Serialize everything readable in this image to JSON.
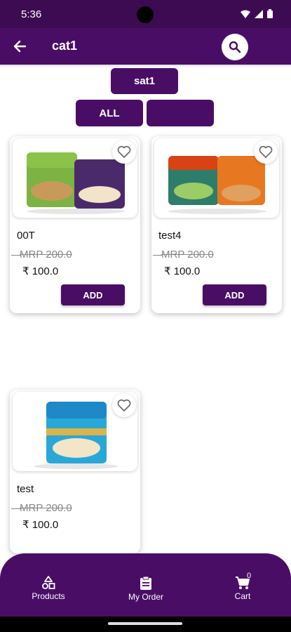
{
  "status_bar": {
    "time": "5:36"
  },
  "app_bar": {
    "title": "cat1",
    "back_icon": "arrow-back-icon",
    "search_icon": "search-icon"
  },
  "subcategory": {
    "label": "sat1"
  },
  "filters": [
    {
      "label": "ALL"
    },
    {
      "label": ""
    }
  ],
  "products": [
    {
      "name": "00T",
      "mrp": "MRP 200.0",
      "price": "₹ 100.0",
      "add_label": "ADD",
      "favorite": false
    },
    {
      "name": "test4",
      "mrp": "MRP 200.0",
      "price": "₹ 100.0",
      "add_label": "ADD",
      "favorite": false
    },
    {
      "name": "test",
      "mrp": "MRP 200.0",
      "price": "₹ 100.0",
      "favorite": false
    }
  ],
  "bottom_nav": {
    "items": [
      {
        "label": "Products",
        "icon": "shapes-icon"
      },
      {
        "label": "My Order",
        "icon": "clipboard-icon"
      },
      {
        "label": "Cart",
        "icon": "cart-icon",
        "badge": "0"
      }
    ]
  },
  "colors": {
    "primary": "#4a0d66",
    "status_bar": "#3d0b52"
  }
}
